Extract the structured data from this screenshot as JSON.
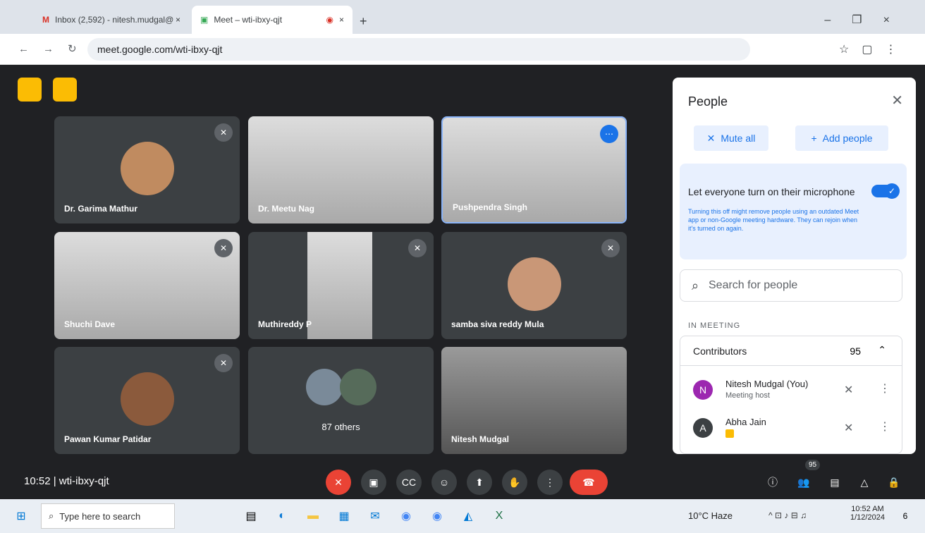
{
  "browser": {
    "tab1": "Inbox (2,592) - nitesh.mudgal@",
    "tab2": "Meet – wti-ibxy-qjt",
    "url": "meet.google.com/wti-ibxy-qjt"
  },
  "meeting": {
    "time": "10:52",
    "code": "wti-ibxy-qjt"
  },
  "tiles": [
    {
      "name": "Dr. Garima Mathur"
    },
    {
      "name": "Dr. Meetu Nag"
    },
    {
      "name": "Pushpendra Singh"
    },
    {
      "name": "Shuchi Dave"
    },
    {
      "name": "Muthireddy P"
    },
    {
      "name": "samba siva reddy Mula"
    },
    {
      "name": "Pawan Kumar Patidar"
    },
    {
      "name": "87 others"
    },
    {
      "name": "Nitesh Mudgal"
    }
  ],
  "people": {
    "title": "People",
    "mute_all": "Mute all",
    "add_people": "Add people",
    "setting_title": "Let everyone turn on their microphone",
    "setting_sub": "Turning this off might remove people using an outdated Meet app or non-Google meeting hardware. They can rejoin when it's turned on again.",
    "search_placeholder": "Search for people",
    "section": "IN MEETING",
    "contributors": "Contributors",
    "count": "95",
    "p1_name": "Nitesh Mudgal (You)",
    "p1_role": "Meeting host",
    "p2_name": "Abha Jain"
  },
  "badge": "95",
  "taskbar": {
    "search": "Type here to search",
    "weather": "10°C  Haze",
    "time": "10:52 AM",
    "date": "1/12/2024",
    "notif": "6"
  }
}
